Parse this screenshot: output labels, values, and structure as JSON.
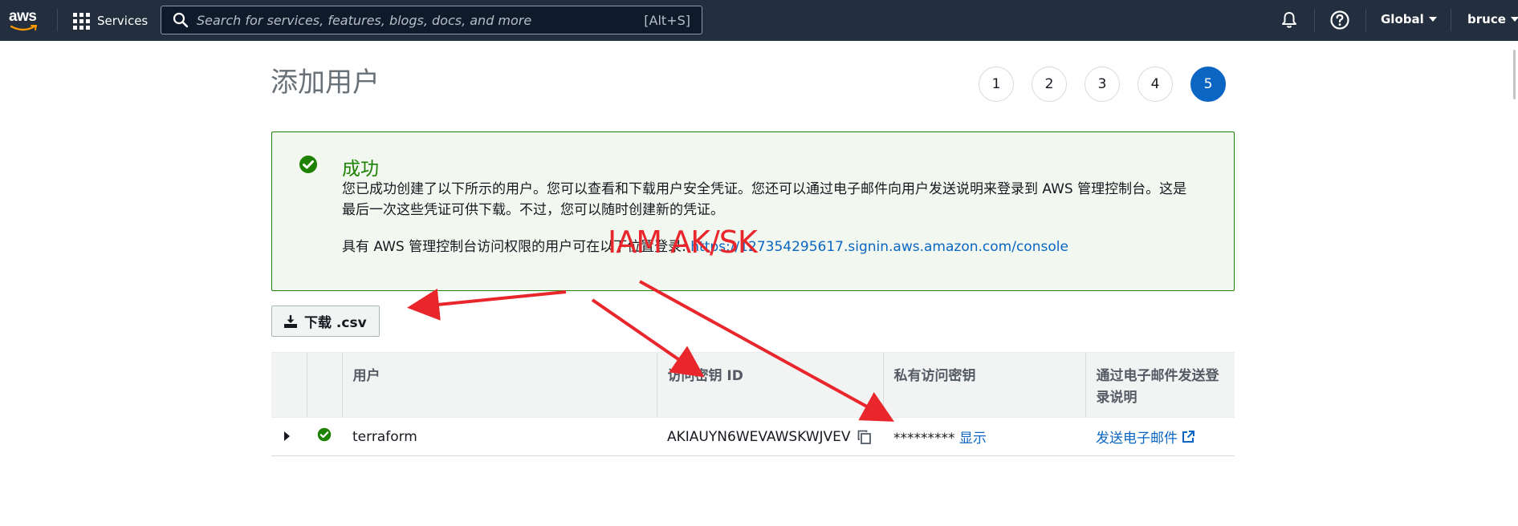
{
  "nav": {
    "logo": "aws",
    "services_label": "Services",
    "search_placeholder": "Search for services, features, blogs, docs, and more",
    "search_shortcut": "[Alt+S]",
    "region": "Global",
    "user": "bruce",
    "icons": [
      "grid-icon",
      "search-icon",
      "bell-icon",
      "help-icon",
      "caret-icon"
    ]
  },
  "page": {
    "title": "添加用户",
    "steps": [
      "1",
      "2",
      "3",
      "4",
      "5"
    ],
    "active_step": "5"
  },
  "alert": {
    "title": "成功",
    "message": "您已成功创建了以下所示的用户。您可以查看和下载用户安全凭证。您还可以通过电子邮件向用户发送说明来登录到 AWS 管理控制台。这是最后一次这些凭证可供下载。不过，您可以随时创建新的凭证。",
    "login_prefix": "具有 AWS 管理控制台访问权限的用户可在以下位置登录: ",
    "login_url": "https://127354295617.signin.aws.amazon.com/console",
    "color": "#1d8102"
  },
  "annotation": {
    "text": "IAM AK/SK",
    "color": "#e8262c"
  },
  "download": {
    "label": "下载 .csv"
  },
  "table": {
    "headers": {
      "user": "用户",
      "access_key_id": "访问密钥 ID",
      "secret_key": "私有访问密钥",
      "email": "通过电子邮件发送登录说明"
    },
    "rows": [
      {
        "user": "terraform",
        "access_key_id": "AKIAUYN6WEVAWSKWJVEV",
        "secret_mask": "*********",
        "show_label": "显示",
        "email_label": "发送电子邮件"
      }
    ]
  },
  "colors": {
    "nav_bg": "#232f3e",
    "link": "#0a66c2",
    "active_step": "#0a66c2"
  }
}
